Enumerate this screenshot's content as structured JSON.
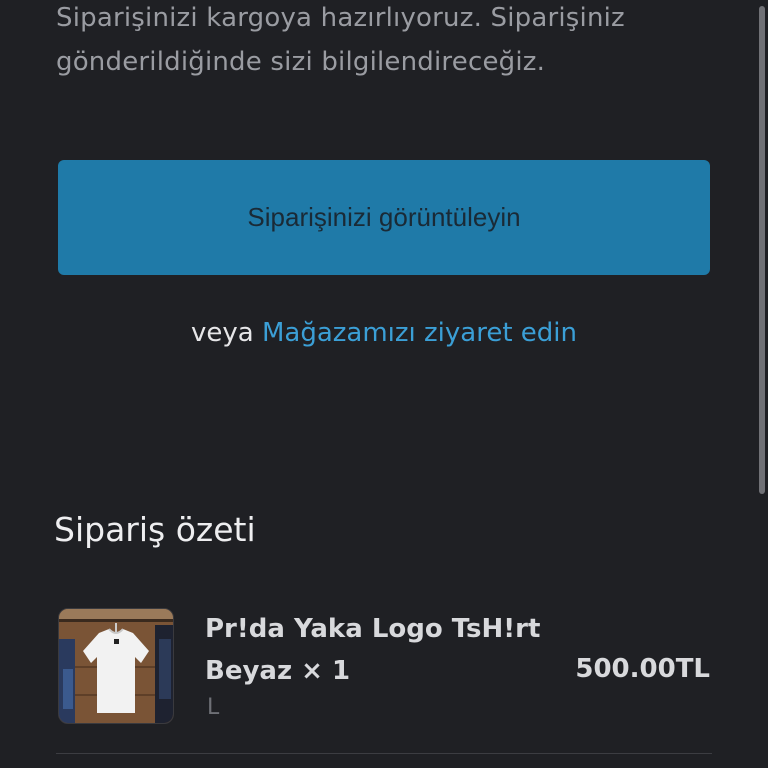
{
  "order_message": "Siparişinizi kargoya hazırlıyoruz. Siparişiniz gönderildiğinde sizi bilgilendireceğiz.",
  "view_order_label": "Siparişinizi görüntüleyin",
  "or_text": "veya",
  "store_link_label": "Mağazamızı ziyaret edin",
  "summary": {
    "title": "Sipariş özeti",
    "items": [
      {
        "name": "Pr!da Yaka Logo TsH!rt Beyaz × 1",
        "variant": "L",
        "price": "500.00TL",
        "image_icon": "white-tshirt-product-photo"
      }
    ]
  },
  "colors": {
    "background": "#1f2024",
    "button": "#1f7aa8",
    "link": "#3b9fd6"
  }
}
